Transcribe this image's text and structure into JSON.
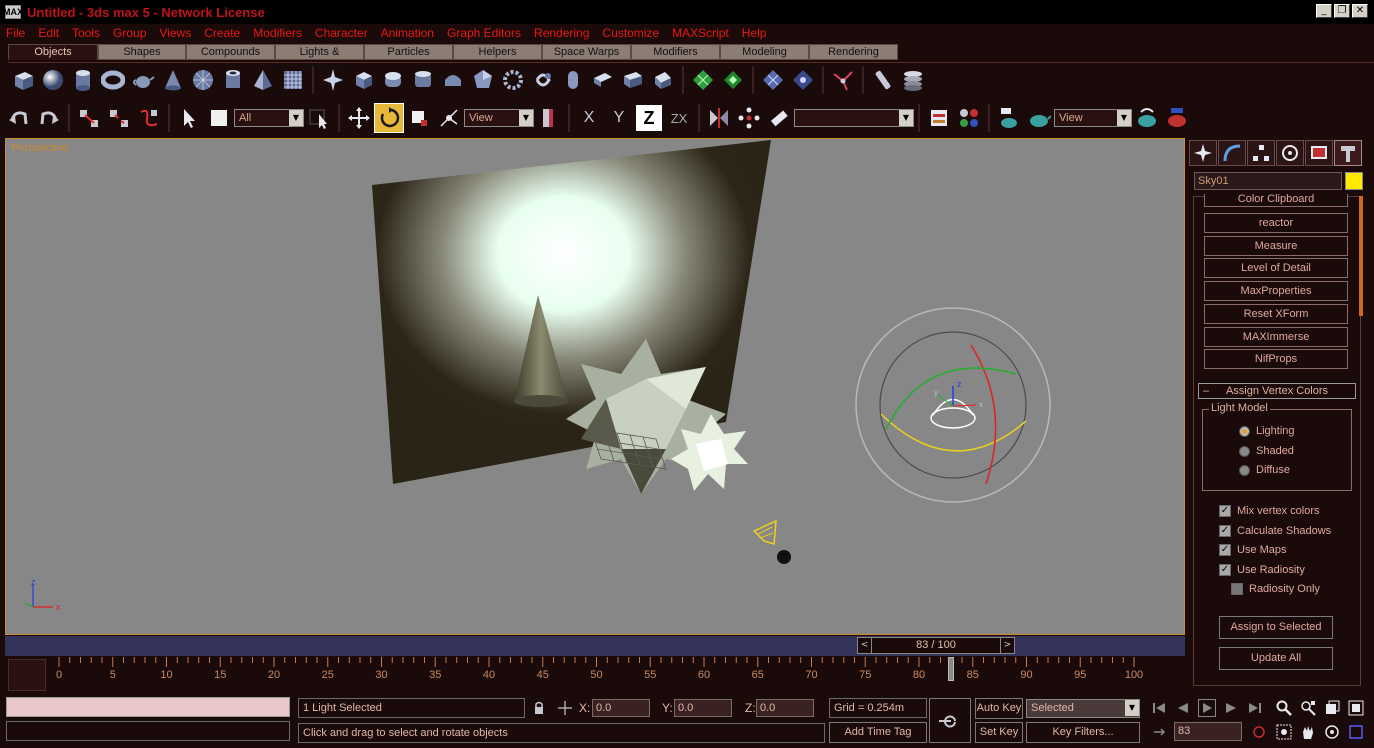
{
  "window": {
    "title": "Untitled - 3ds max 5 - Network License",
    "app_icon": "MAX",
    "minimize": "_",
    "restore": "❐",
    "close": "✕"
  },
  "menu": [
    "File",
    "Edit",
    "Tools",
    "Group",
    "Views",
    "Create",
    "Modifiers",
    "Character",
    "Animation",
    "Graph Editors",
    "Rendering",
    "Customize",
    "MAXScript",
    "Help"
  ],
  "tabs": [
    {
      "label": "Objects",
      "active": true
    },
    {
      "label": "Shapes"
    },
    {
      "label": "Compounds"
    },
    {
      "label": "Lights & Cameras"
    },
    {
      "label": "Particles"
    },
    {
      "label": "Helpers"
    },
    {
      "label": "Space Warps"
    },
    {
      "label": "Modifiers"
    },
    {
      "label": "Modeling"
    },
    {
      "label": "Rendering"
    }
  ],
  "main_toolbar": {
    "selection_filter": "All",
    "ref_coord": "View",
    "axis_x": "X",
    "axis_y": "Y",
    "axis_z": "Z",
    "axis_zx": "ZX",
    "named_selection": "",
    "render_view": "View"
  },
  "viewport": {
    "label": "Perspective",
    "axis_x": "x",
    "axis_z": "z"
  },
  "command_panel": {
    "object_name": "Sky01",
    "object_color": "#ffea00",
    "utilities": [
      "Color Clipboard",
      "reactor",
      "Measure",
      "Level of Detail",
      "MaxProperties",
      "Reset XForm",
      "MAXImmerse",
      "NifProps"
    ],
    "rollout": {
      "minus": "–",
      "title": "Assign Vertex Colors",
      "light_model_label": "Light Model",
      "light_models": [
        {
          "label": "Lighting",
          "checked": true
        },
        {
          "label": "Shaded",
          "checked": false
        },
        {
          "label": "Diffuse",
          "checked": false
        }
      ],
      "options": [
        {
          "label": "Mix vertex colors",
          "checked": true
        },
        {
          "label": "Calculate Shadows",
          "checked": true
        },
        {
          "label": "Use Maps",
          "checked": true
        },
        {
          "label": "Use Radiosity",
          "checked": true
        },
        {
          "label": "Radiosity Only",
          "checked": false
        }
      ],
      "assign_button": "Assign to Selected",
      "update_button": "Update All"
    }
  },
  "time": {
    "frame_display": "83 / 100",
    "current_frame": 83,
    "total_frames": 100,
    "prev": "<",
    "next": ">",
    "ticks": [
      "0",
      "5",
      "10",
      "15",
      "20",
      "25",
      "30",
      "35",
      "40",
      "45",
      "50",
      "55",
      "60",
      "65",
      "70",
      "75",
      "80",
      "85",
      "90",
      "95",
      "100"
    ]
  },
  "status": {
    "selection_info": "1 Light Selected",
    "prompt": "Click and drag to select and rotate objects",
    "x_label": "X:",
    "y_label": "Y:",
    "z_label": "Z:",
    "x_value": "0.0",
    "y_value": "0.0",
    "z_value": "0.0",
    "grid": "Grid = 0.254m",
    "add_time_tag": "Add Time Tag",
    "auto_key": "Auto Key",
    "set_key": "Set Key",
    "key_mode": "Selected",
    "key_filters": "Key Filters...",
    "frame_field": "83"
  }
}
